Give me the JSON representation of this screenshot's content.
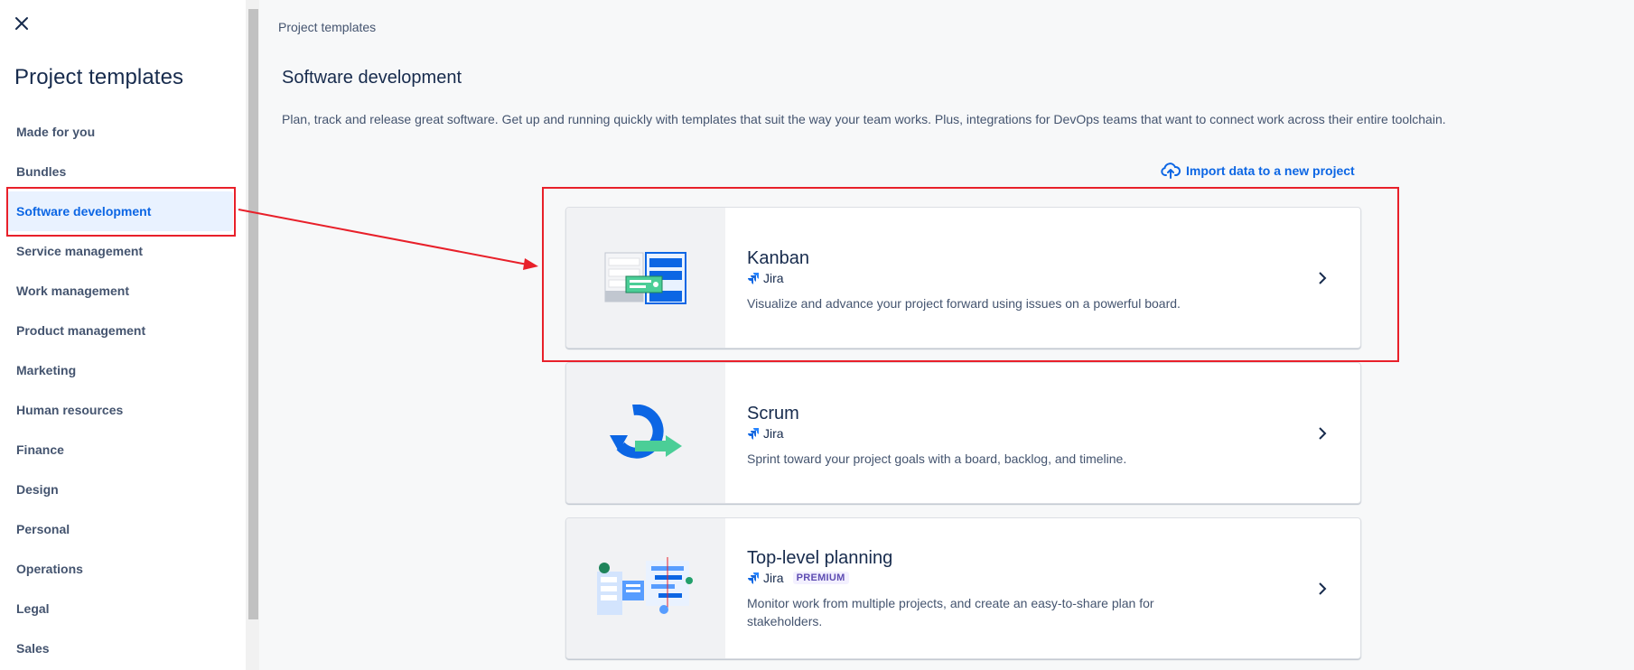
{
  "sidebar": {
    "title": "Project templates",
    "items": [
      {
        "label": "Made for you"
      },
      {
        "label": "Bundles"
      },
      {
        "label": "Software development"
      },
      {
        "label": "Service management"
      },
      {
        "label": "Work management"
      },
      {
        "label": "Product management"
      },
      {
        "label": "Marketing"
      },
      {
        "label": "Human resources"
      },
      {
        "label": "Finance"
      },
      {
        "label": "Design"
      },
      {
        "label": "Personal"
      },
      {
        "label": "Operations"
      },
      {
        "label": "Legal"
      },
      {
        "label": "Sales"
      }
    ],
    "selected": "Software development"
  },
  "main": {
    "breadcrumb": "Project templates",
    "title": "Software development",
    "description": "Plan, track and release great software. Get up and running quickly with templates that suit the way your team works. Plus, integrations for DevOps teams that want to connect work across their entire toolchain.",
    "import_link": "Import data to a new project",
    "cards": [
      {
        "title": "Kanban",
        "product": "Jira",
        "description": "Visualize and advance your project forward using issues on a powerful board."
      },
      {
        "title": "Scrum",
        "product": "Jira",
        "description": "Sprint toward your project goals with a board, backlog, and timeline."
      },
      {
        "title": "Top-level planning",
        "product": "Jira",
        "badge": "PREMIUM",
        "description": "Monitor work from multiple projects, and create an easy-to-share plan for stakeholders."
      }
    ]
  },
  "colors": {
    "accent": "#0c66e4",
    "annotation": "#e8202a",
    "selected_bg": "#e9f2ff"
  }
}
